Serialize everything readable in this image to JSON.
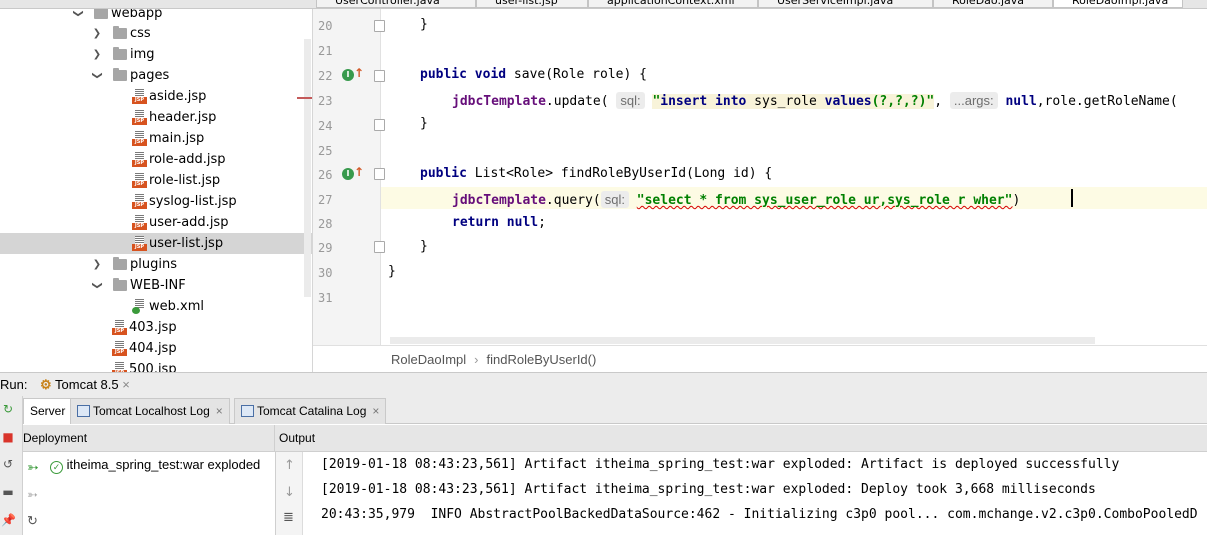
{
  "editor_tabs": [
    "UserController.java",
    "user-list.jsp",
    "applicationContext.xml",
    "UserServiceImpl.java",
    "RoleDao.java",
    "RoleDaoImpl.java"
  ],
  "project_tree": {
    "items": [
      {
        "label": "webapp",
        "type": "folder",
        "expanded": true
      },
      {
        "label": "css",
        "type": "folder",
        "expanded": false
      },
      {
        "label": "img",
        "type": "folder",
        "expanded": false
      },
      {
        "label": "pages",
        "type": "folder",
        "expanded": true
      },
      {
        "label": "aside.jsp",
        "type": "jsp"
      },
      {
        "label": "header.jsp",
        "type": "jsp"
      },
      {
        "label": "main.jsp",
        "type": "jsp"
      },
      {
        "label": "role-add.jsp",
        "type": "jsp"
      },
      {
        "label": "role-list.jsp",
        "type": "jsp"
      },
      {
        "label": "syslog-list.jsp",
        "type": "jsp"
      },
      {
        "label": "user-add.jsp",
        "type": "jsp"
      },
      {
        "label": "user-list.jsp",
        "type": "jsp",
        "selected": true
      },
      {
        "label": "plugins",
        "type": "folder",
        "expanded": false
      },
      {
        "label": "WEB-INF",
        "type": "folder",
        "expanded": true
      },
      {
        "label": "web.xml",
        "type": "xml"
      },
      {
        "label": "403.jsp",
        "type": "jsp"
      },
      {
        "label": "404.jsp",
        "type": "jsp"
      },
      {
        "label": "500.jsp",
        "type": "jsp"
      }
    ]
  },
  "editor": {
    "line_numbers": [
      "20",
      "21",
      "22",
      "23",
      "24",
      "25",
      "26",
      "27",
      "28",
      "29",
      "30",
      "31"
    ],
    "lines": {
      "l20": "}",
      "l22_kw": "public void",
      "l22_rest": " save(Role role) {",
      "l23_field": "jdbcTemplate",
      "l23_call": ".update(",
      "l23_hint": "sql:",
      "l23_str_a": "\"",
      "l23_str_kw1": "insert into",
      "l23_str_mid": " sys_role ",
      "l23_str_kw2": "values",
      "l23_str_b": "(?,?,?)\"",
      "l23_sep": ", ",
      "l23_hint2": "...args:",
      "l23_null": " null",
      "l23_tail": ",role.getRoleName(",
      "l24": "}",
      "l26_kw": "public",
      "l26_rest": " List<Role> findRoleByUserId(Long id) {",
      "l27_field": "jdbcTemplate",
      "l27_call": ".query(",
      "l27_hint": "sql:",
      "l27_str": "\"select * from sys_user_role ur,sys_role r wher\"",
      "l27_close": ")",
      "l28_kw": "return null",
      "l28_semi": ";",
      "l29": "}",
      "l30": "}"
    }
  },
  "breadcrumb": {
    "class": "RoleDaoImpl",
    "method": "findRoleByUserId()"
  },
  "run": {
    "label": "Run:",
    "config": "Tomcat 8.5",
    "tabs": [
      {
        "label": "Server",
        "active": true
      },
      {
        "label": "Tomcat Localhost Log"
      },
      {
        "label": "Tomcat Catalina Log"
      }
    ],
    "deployment_header": "Deployment",
    "output_header": "Output",
    "deployment_item": "itheima_spring_test:war exploded",
    "output_lines": [
      "[2019-01-18 08:43:23,561] Artifact itheima_spring_test:war exploded: Artifact is deployed successfully",
      "[2019-01-18 08:43:23,561] Artifact itheima_spring_test:war exploded: Deploy took 3,668 milliseconds",
      "20:43:35,979  INFO AbstractPoolBackedDataSource:462 - Initializing c3p0 pool... com.mchange.v2.c3p0.ComboPooledD"
    ]
  },
  "colors": {
    "keyword": "#000080",
    "field": "#660e7a",
    "string": "#008000",
    "selection": "#d5d5d5"
  }
}
